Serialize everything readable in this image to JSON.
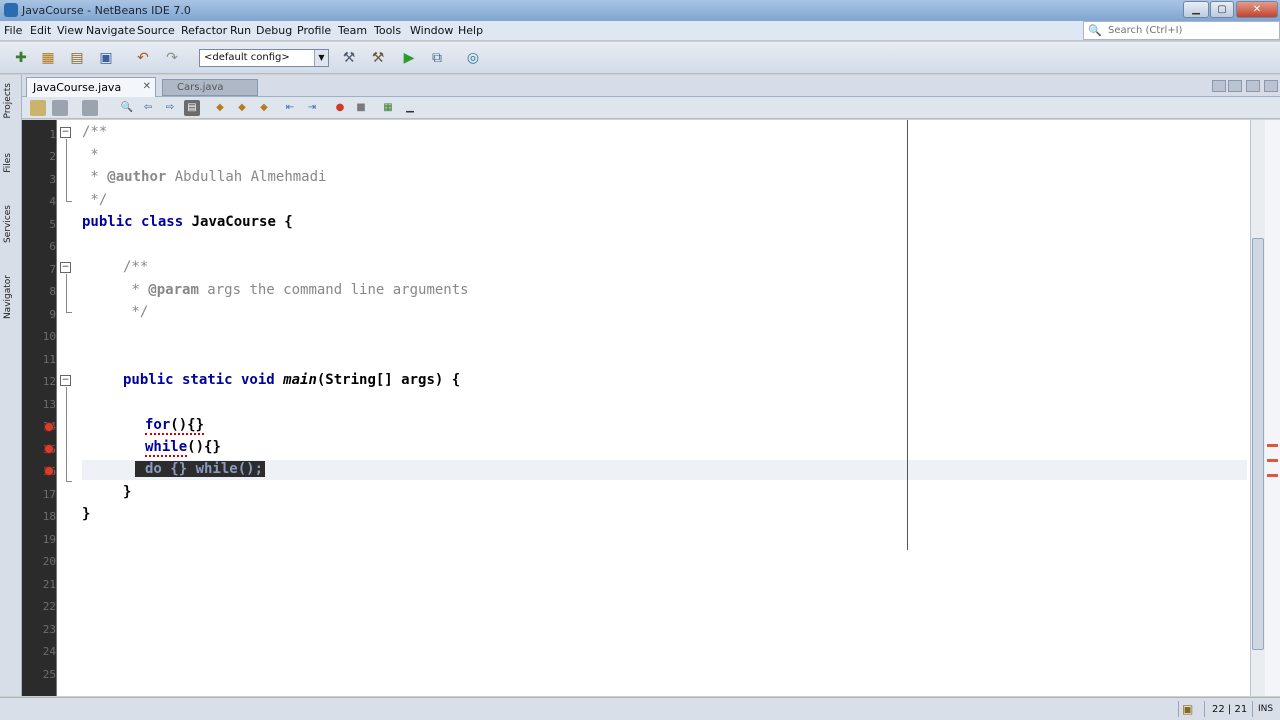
{
  "window": {
    "title": "JavaCourse - NetBeans IDE 7.0",
    "min_label": "▁",
    "max_label": "▢",
    "close_label": "✕"
  },
  "menu": [
    "File",
    "Edit",
    "View",
    "Navigate",
    "Source",
    "Refactor",
    "Run",
    "Debug",
    "Profile",
    "Team",
    "Tools",
    "Window",
    "Help"
  ],
  "search": {
    "placeholder": "Search (Ctrl+I)"
  },
  "toolbar": {
    "config": "<default config>"
  },
  "sidebar": {
    "tabs": [
      "Projects",
      "Files",
      "Services",
      "Navigator"
    ]
  },
  "tabs": [
    {
      "label": "JavaCourse.java",
      "close": "✕"
    },
    {
      "label": "Cars.java"
    }
  ],
  "editor": {
    "line_numbers": [
      "1",
      "2",
      "3",
      "4",
      "5",
      "6",
      "7",
      "8",
      "9",
      "10",
      "11",
      "12",
      "13",
      "14",
      "15",
      "16",
      "17",
      "18",
      "19",
      "20",
      "21",
      "22",
      "23",
      "24",
      "25"
    ],
    "lines": {
      "l1": "/**",
      "l2": " *",
      "l3_a": " * ",
      "l3_tag": "@author",
      "l3_b": " Abdullah Almehmadi",
      "l4": " */",
      "l5_kw": "public class",
      "l5_name": " JavaCourse {",
      "l6": "/**",
      "l7_a": " * ",
      "l7_tag": "@param",
      "l7_b": " args the command line arguments",
      "l8": " */",
      "l9_kw": "public static void",
      "l9_fn": "main",
      "l9_rest": "(String[] args) {",
      "l10_kw": "for",
      "l10_rest": "(){}",
      "l11_kw": "while",
      "l11_rest": "(){}",
      "l12": "do {} while();",
      "l13": "}",
      "l14": "}"
    }
  },
  "status": {
    "position": "22 | 21",
    "mode": "INS"
  },
  "colors": {
    "keyword": "#0000a0",
    "comment": "#888888",
    "error": "#d00000"
  }
}
